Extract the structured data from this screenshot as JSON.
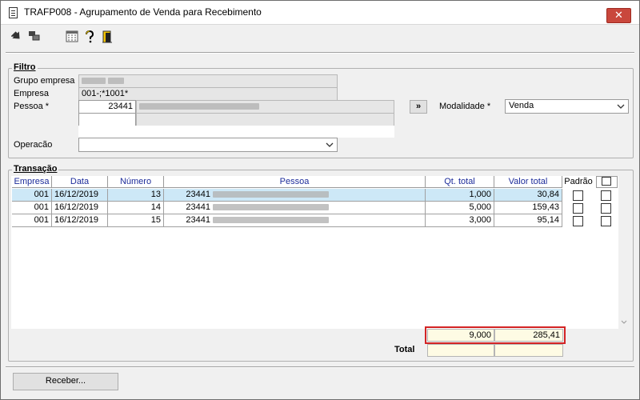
{
  "window": {
    "title": "TRAFP008 - Agrupamento de Venda para Recebimento",
    "close_label": "✕"
  },
  "toolbar": {
    "icons": [
      "arrow-icon",
      "windows-icon",
      "calculator-icon",
      "help-icon",
      "exit-icon"
    ]
  },
  "filtro": {
    "legend": "Filtro",
    "grupo_empresa_label": "Grupo empresa",
    "empresa_label": "Empresa",
    "empresa_value": "001-;*1001*",
    "pessoa_label": "Pessoa *",
    "pessoa_code": "23441",
    "pessoa_button_label": "»",
    "modalidade_label": "Modalidade *",
    "modalidade_value": "Venda",
    "operacao_label": "Operacão",
    "operacao_value": ""
  },
  "transacao": {
    "legend": "Transação",
    "columns": {
      "empresa": "Empresa",
      "data": "Data",
      "numero": "Número",
      "pessoa": "Pessoa",
      "qt_total": "Qt. total",
      "valor_total": "Valor  total",
      "padrao": "Padrão"
    },
    "rows": [
      {
        "empresa": "001",
        "data": "16/12/2019",
        "numero": "13",
        "pessoa_code": "23441",
        "qt_total": "1,000",
        "valor_total": "30,84"
      },
      {
        "empresa": "001",
        "data": "16/12/2019",
        "numero": "14",
        "pessoa_code": "23441",
        "qt_total": "5,000",
        "valor_total": "159,43"
      },
      {
        "empresa": "001",
        "data": "16/12/2019",
        "numero": "15",
        "pessoa_code": "23441",
        "qt_total": "3,000",
        "valor_total": "95,14"
      }
    ],
    "total_label": "Total",
    "total_qt": "9,000",
    "total_valor": "285,41"
  },
  "footer": {
    "receber_label": "Receber..."
  },
  "colors": {
    "header_text": "#1d2c9a",
    "selected_row": "#cde8f7",
    "highlight_border": "#d32424",
    "total_bg": "#fefbe4"
  }
}
